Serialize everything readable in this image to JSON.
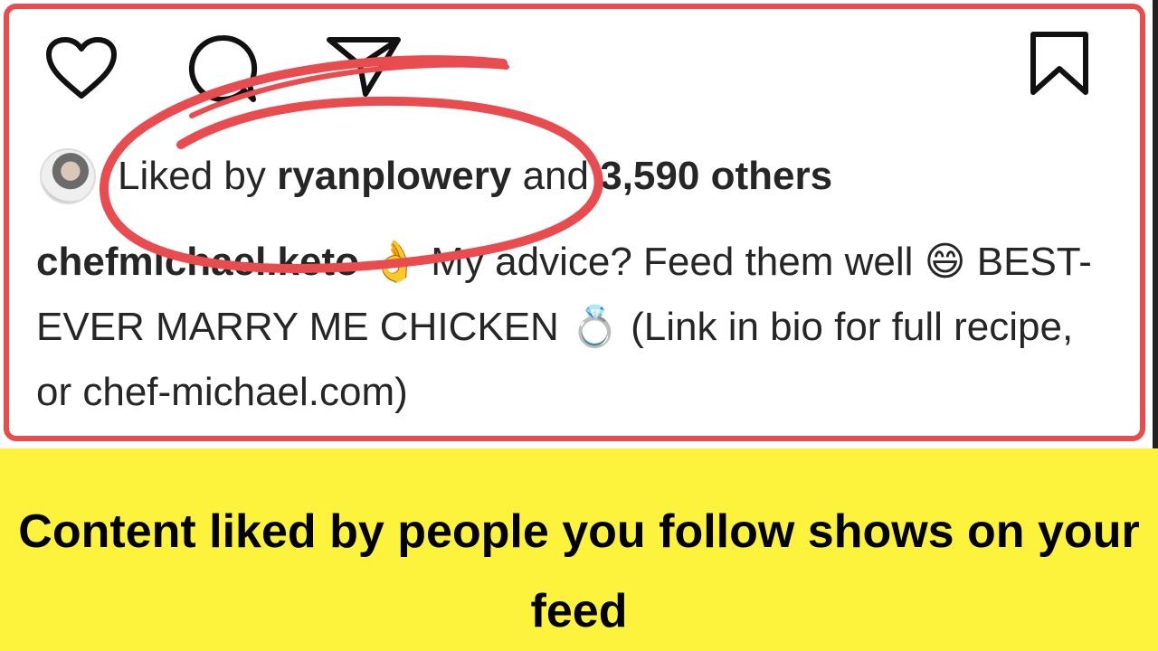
{
  "post": {
    "actions": {
      "like_icon": "heart-icon",
      "comment_icon": "comment-icon",
      "share_icon": "paper-plane-icon",
      "save_icon": "bookmark-icon"
    },
    "likes": {
      "prefix": "Liked by",
      "user": "ryanplowery",
      "connector": "and",
      "count_text": "3,590 others"
    },
    "caption": {
      "author": "chefmichael.keto",
      "emoji_1": "👌",
      "text_1": "My advice? Feed them well",
      "emoji_2": "😄",
      "text_2": "BEST-EVER MARRY ME CHICKEN",
      "emoji_3": "💍",
      "text_3": "(Link in bio for full recipe, or chef-michael.com)"
    }
  },
  "annotation": {
    "frame_color": "#e84c4f",
    "circle_color": "#e84c4f"
  },
  "banner": {
    "text": "Content liked by people you follow shows on your feed",
    "background": "#fdf33c"
  }
}
